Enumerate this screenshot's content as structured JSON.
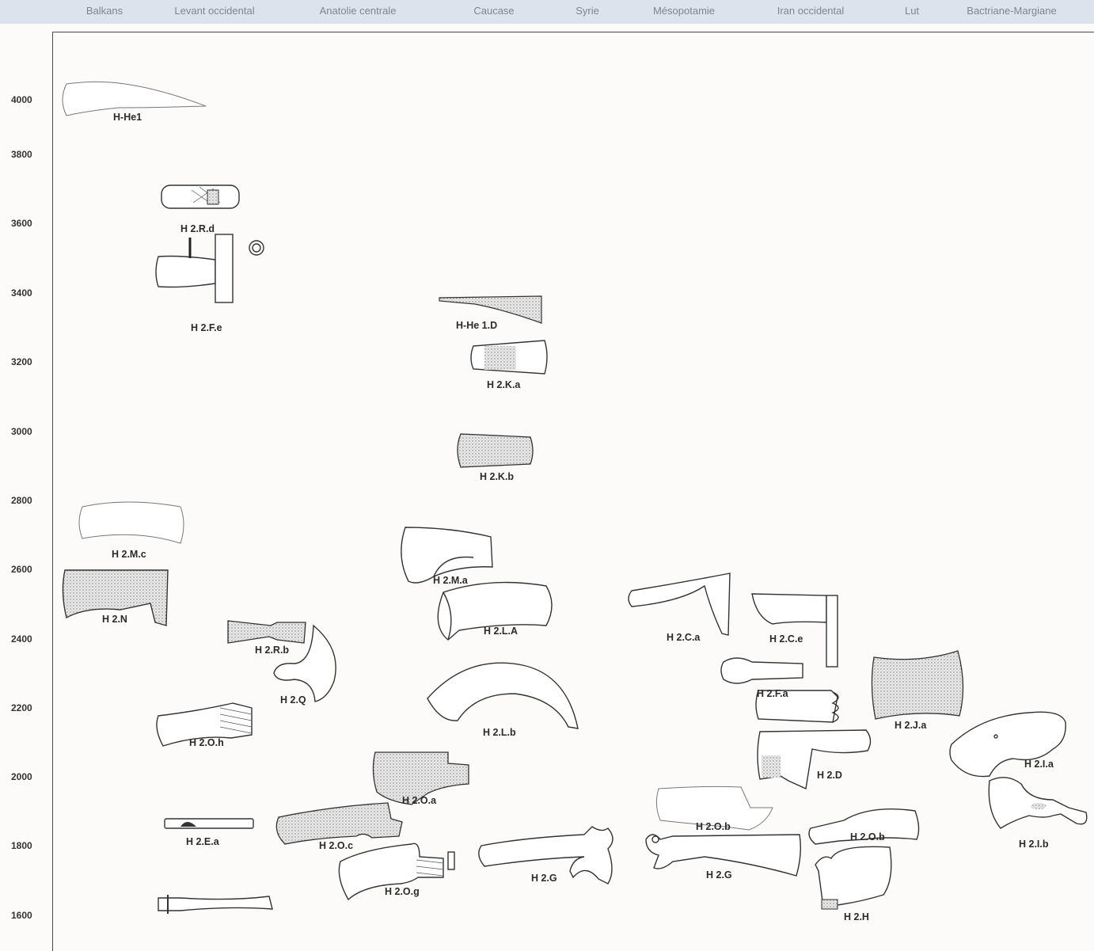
{
  "regions": [
    "Balkans",
    "Levant occidental",
    "Anatolie centrale",
    "Caucase",
    "Syrie",
    "Mésopotamie",
    "Iran occidental",
    "Lut",
    "Bactriane-Margiane"
  ],
  "years": [
    "4000",
    "3800",
    "3600",
    "3400",
    "3200",
    "3000",
    "2800",
    "2600",
    "2400",
    "2200",
    "2000",
    "1800",
    "1600"
  ],
  "types": [
    "H-He1",
    "H 2.R.d",
    "H 2.F.e",
    "H-He 1.D",
    "H 2.K.a",
    "H 2.K.b",
    "H 2.M.c",
    "H 2.M.a",
    "H 2.N",
    "H 2.L.A",
    "H 2.C.a",
    "H 2.C.e",
    "H 2.R.b",
    "H 2.Q",
    "H 2.F.a",
    "H 2.J.a",
    "H 2.L.b",
    "H 2.O.h",
    "H 2.D",
    "H 2.I.a",
    "H 2.O.a",
    "H 2.O.b",
    "H 2.O.b",
    "H 2.E.a",
    "H 2.O.c",
    "H 2.I.b",
    "H 2.G",
    "H 2.G",
    "H 2.O.g",
    "H 2.H"
  ],
  "colors": {
    "header_bg": "#dde3ec",
    "header_text": "#7d8594",
    "axis": "#4a4a4a",
    "background": "#fcfbfa"
  }
}
